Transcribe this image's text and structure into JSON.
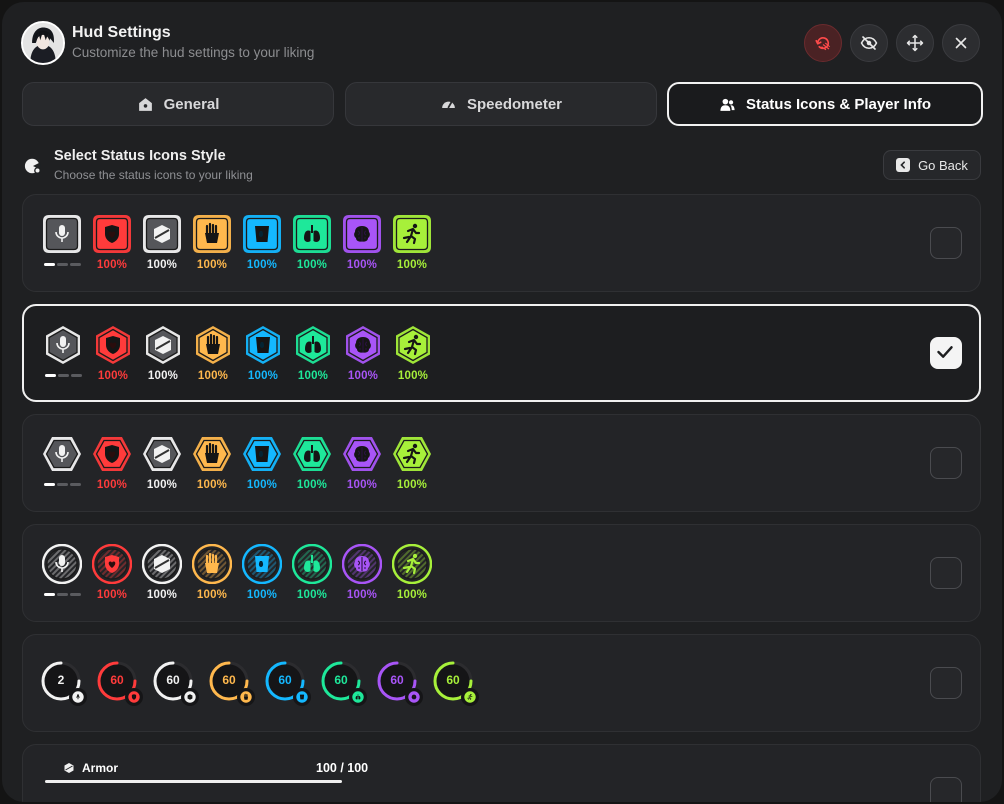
{
  "header": {
    "title": "Hud Settings",
    "subtitle": "Customize the hud settings to your liking",
    "buttons": [
      "reset-icon",
      "eye-off-icon",
      "move-icon",
      "close-icon"
    ]
  },
  "tabs": [
    {
      "label": "General",
      "icon": "home-icon"
    },
    {
      "label": "Speedometer",
      "icon": "gauge-icon"
    },
    {
      "label": "Status Icons & Player Info",
      "icon": "users-icon",
      "active": true
    }
  ],
  "section": {
    "title": "Select Status Icons Style",
    "subtitle": "Choose the status icons to your liking",
    "go_back": "Go Back"
  },
  "status_colors": {
    "voice": "#f2f2f2",
    "health": "#ff3b3b",
    "armor": "#f2f2f2",
    "hunger": "#ffb84d",
    "thirst": "#14b8ff",
    "oxygen": "#1ee89a",
    "stress": "#a855f7",
    "stamina": "#a7f03a"
  },
  "status_values": {
    "health": "100%",
    "armor": "100%",
    "hunger": "100%",
    "thirst": "100%",
    "oxygen": "100%",
    "stress": "100%",
    "stamina": "100%"
  },
  "ring_values": {
    "voice": "2",
    "health": "60",
    "armor": "60",
    "hunger": "60",
    "thirst": "60",
    "oxygen": "60",
    "stress": "60",
    "stamina": "60"
  },
  "styles": [
    {
      "shape": "rounded-square",
      "selected": false
    },
    {
      "shape": "hexagon-vertical",
      "selected": true
    },
    {
      "shape": "hexagon-horizontal",
      "selected": false
    },
    {
      "shape": "circle",
      "selected": false
    },
    {
      "shape": "ring",
      "selected": false
    },
    {
      "shape": "bar",
      "selected": false
    }
  ],
  "armor_bar": {
    "label": "Armor",
    "value": "100 / 100",
    "fill": 1.0
  }
}
